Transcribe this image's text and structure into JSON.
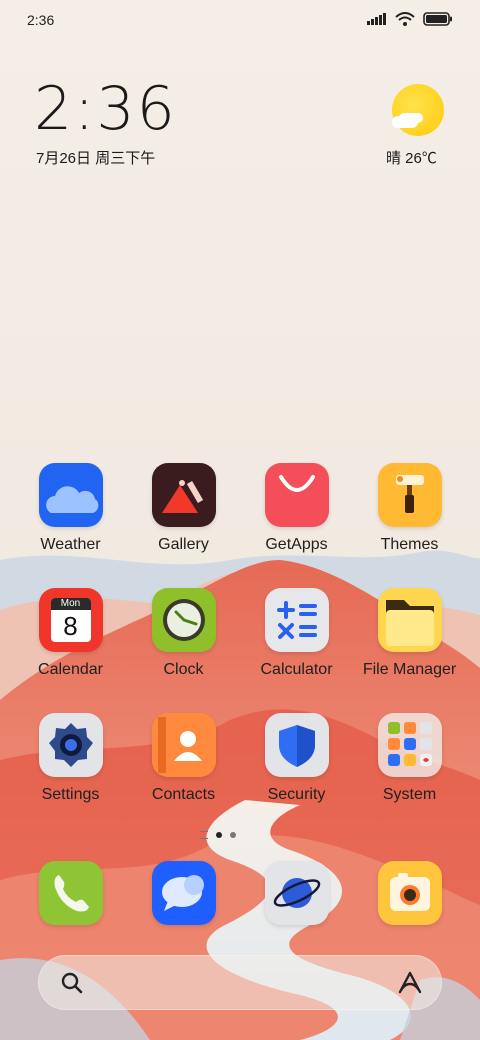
{
  "status_bar": {
    "time": "2:36"
  },
  "clock_widget": {
    "time": "2:36",
    "date": "7月26日 周三下午",
    "weather": "晴 26℃"
  },
  "apps": [
    {
      "label": "Weather",
      "icon": "weather-icon"
    },
    {
      "label": "Gallery",
      "icon": "gallery-icon"
    },
    {
      "label": "GetApps",
      "icon": "getapps-icon"
    },
    {
      "label": "Themes",
      "icon": "themes-icon"
    },
    {
      "label": "Calendar",
      "icon": "calendar-icon",
      "icon_text": {
        "weekday": "Mon",
        "day": "8"
      }
    },
    {
      "label": "Clock",
      "icon": "clock-icon"
    },
    {
      "label": "Calculator",
      "icon": "calculator-icon"
    },
    {
      "label": "File Manager",
      "icon": "file-manager-icon"
    },
    {
      "label": "Settings",
      "icon": "settings-icon"
    },
    {
      "label": "Contacts",
      "icon": "contacts-icon"
    },
    {
      "label": "Security",
      "icon": "security-icon"
    },
    {
      "label": "System",
      "icon": "folder-icon"
    }
  ],
  "dock": [
    {
      "icon": "phone-icon"
    },
    {
      "icon": "messages-icon"
    },
    {
      "icon": "browser-icon"
    },
    {
      "icon": "camera-icon"
    }
  ],
  "search_bar": {
    "left_icon": "search-icon",
    "right_icon": "assistant-icon"
  },
  "colors": {
    "background": "#f3ede6",
    "mountain_red": "#e2634f",
    "accent_blue": "#1f5eff"
  }
}
